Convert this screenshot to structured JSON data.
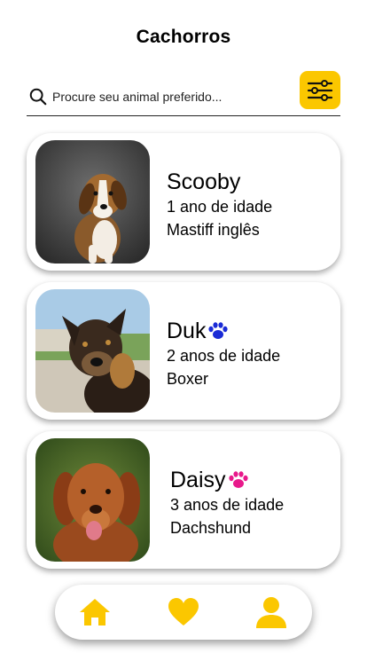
{
  "header": {
    "title": "Cachorros"
  },
  "search": {
    "placeholder": "Procure seu animal preferido..."
  },
  "colors": {
    "accent": "#fbc700",
    "male_paw": "#1a2bd6",
    "female_paw": "#e8198b"
  },
  "pets": [
    {
      "name": "Scooby",
      "age": "1 ano de idade",
      "breed": "Mastiff inglês",
      "paw_icon": ""
    },
    {
      "name": "Duk",
      "age": "2 anos de idade",
      "breed": "Boxer",
      "paw_icon": "paw-blue-icon"
    },
    {
      "name": "Daisy",
      "age": "3 anos de idade",
      "breed": "Dachshund",
      "paw_icon": "paw-pink-icon"
    }
  ],
  "bottom_nav": {
    "items": [
      "home-icon",
      "heart-icon",
      "user-icon"
    ]
  }
}
